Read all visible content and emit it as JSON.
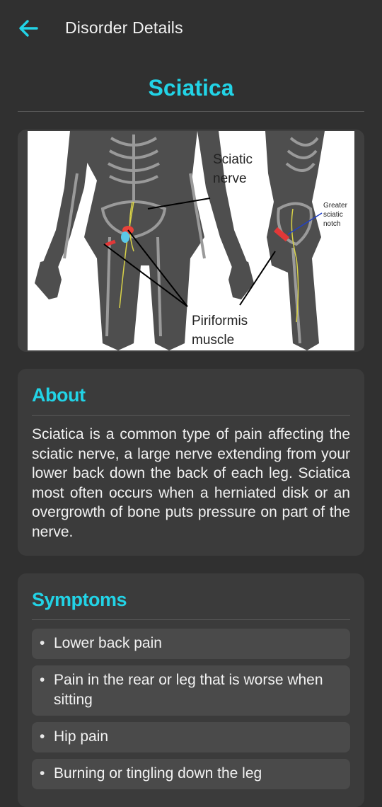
{
  "appbar": {
    "title": "Disorder Details",
    "back_icon": "arrow-left-icon"
  },
  "disorder": {
    "name": "Sciatica"
  },
  "illustration": {
    "label_sciatic": "Sciatic",
    "label_nerve": "nerve",
    "label_piriformis": "Piriformis",
    "label_muscle": "muscle",
    "label_greater": "Greater",
    "label_sciatic_small": "sciatic",
    "label_notch": "notch"
  },
  "about": {
    "heading": "About",
    "text": "Sciatica is a common type of pain affecting the sciatic nerve, a large nerve extending from your lower back down the back of each leg. Sciatica most often occurs when a herniated disk or an overgrowth of bone puts pressure on part of the nerve."
  },
  "symptoms": {
    "heading": "Symptoms",
    "items": [
      {
        "text": "Lower back pain"
      },
      {
        "text": "Pain in the rear or leg that is worse when sitting"
      },
      {
        "text": "Hip pain"
      },
      {
        "text": "Burning or tingling down the leg"
      }
    ]
  },
  "colors": {
    "accent": "#22d3e6",
    "background": "#303030",
    "card": "#3b3b3b",
    "chip": "#4a4a4a"
  }
}
